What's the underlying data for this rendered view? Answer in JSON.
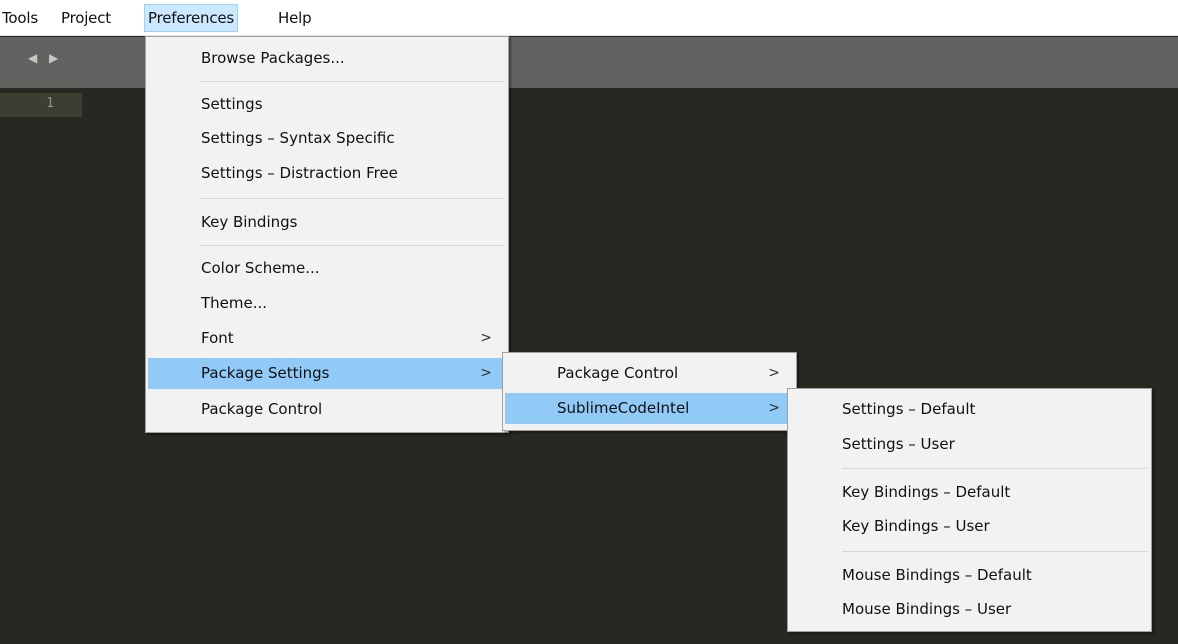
{
  "menubar": {
    "items": [
      {
        "label": "Tools",
        "active": false
      },
      {
        "label": "Project",
        "active": false
      },
      {
        "label": "Preferences",
        "active": true
      },
      {
        "label": "Help",
        "active": false
      }
    ]
  },
  "tabbar": {
    "nav_arrows": "◀ ▶"
  },
  "editor": {
    "line_number": "1"
  },
  "preferences_menu": {
    "items": [
      {
        "label": "Browse Packages...",
        "submenu": false
      },
      {
        "label": "Settings",
        "submenu": false
      },
      {
        "label": "Settings – Syntax Specific",
        "submenu": false
      },
      {
        "label": "Settings – Distraction Free",
        "submenu": false
      },
      {
        "label": "Key Bindings",
        "submenu": false
      },
      {
        "label": "Color Scheme...",
        "submenu": false
      },
      {
        "label": "Theme...",
        "submenu": false
      },
      {
        "label": "Font",
        "submenu": true
      },
      {
        "label": "Package Settings",
        "submenu": true,
        "highlighted": true
      },
      {
        "label": "Package Control",
        "submenu": false
      }
    ]
  },
  "package_settings_menu": {
    "items": [
      {
        "label": "Package Control",
        "submenu": true
      },
      {
        "label": "SublimeCodeIntel",
        "submenu": true,
        "highlighted": true
      }
    ]
  },
  "sublimecodeintel_menu": {
    "items": [
      {
        "label": "Settings – Default"
      },
      {
        "label": "Settings – User"
      },
      {
        "label": "Key Bindings – Default"
      },
      {
        "label": "Key Bindings – User"
      },
      {
        "label": "Mouse Bindings – Default"
      },
      {
        "label": "Mouse Bindings – User"
      }
    ]
  },
  "glyphs": {
    "submenu_arrow": ">"
  },
  "colors": {
    "editor_bg": "#272822",
    "tabbar_bg": "#626260",
    "menu_bg": "#f2f2f2",
    "menu_highlight": "#91c9f7",
    "menubar_active": "#cce8ff"
  }
}
